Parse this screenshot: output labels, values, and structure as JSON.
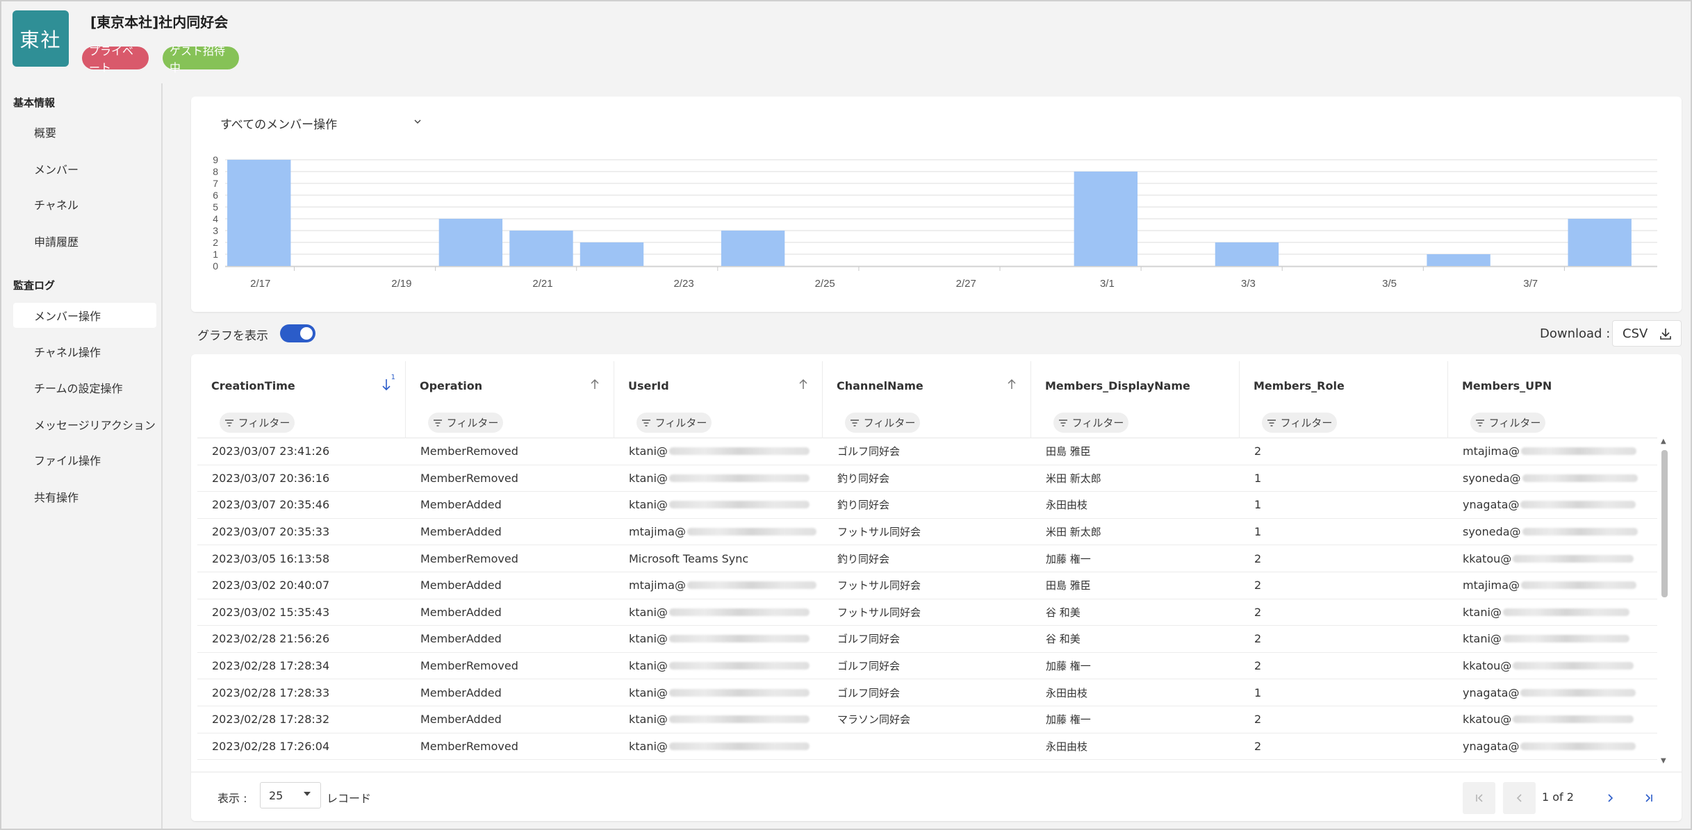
{
  "team": {
    "avatar_text": "東社",
    "title": "[東京本社]社内同好会",
    "badges": {
      "private": "プライベート",
      "guest": "ゲスト招待中"
    }
  },
  "sidebar": {
    "section_basic": "基本情報",
    "basic_items": [
      "概要",
      "メンバー",
      "チャネル",
      "申請履歴"
    ],
    "section_audit": "監査ログ",
    "audit_items": [
      "メンバー操作",
      "チャネル操作",
      "チームの設定操作",
      "メッセージリアクション",
      "ファイル操作",
      "共有操作"
    ],
    "active_item": "メンバー操作"
  },
  "chart": {
    "selector_label": "すべてのメンバー操作"
  },
  "chart_data": {
    "type": "bar",
    "categories": [
      "2/17",
      "2/18",
      "2/19",
      "2/20",
      "2/21",
      "2/22",
      "2/23",
      "2/24",
      "2/25",
      "2/26",
      "2/27",
      "2/28",
      "3/1",
      "3/2",
      "3/3",
      "3/4",
      "3/5",
      "3/6",
      "3/7",
      "3/8"
    ],
    "x_tick_labels": [
      "2/17",
      "2/19",
      "2/21",
      "2/23",
      "2/25",
      "2/27",
      "3/1",
      "3/3",
      "3/5",
      "3/7"
    ],
    "values": [
      9,
      0,
      0,
      4,
      3,
      2,
      0,
      3,
      0,
      0,
      0,
      0,
      8,
      0,
      2,
      0,
      0,
      1,
      0,
      4
    ],
    "y_ticks": [
      0,
      1,
      2,
      3,
      4,
      5,
      6,
      7,
      8,
      9
    ],
    "ylim": [
      0,
      9
    ],
    "grid": true,
    "bar_color": "#9dc3f5",
    "title": "",
    "xlabel": "",
    "ylabel": ""
  },
  "controls": {
    "toggle_label": "グラフを表示",
    "toggle_on": true,
    "download_label": "Download :",
    "csv_label": "CSV"
  },
  "table": {
    "columns": [
      "CreationTime",
      "Operation",
      "UserId",
      "ChannelName",
      "Members_DisplayName",
      "Members_Role",
      "Members_UPN"
    ],
    "filter_label": "フィルター",
    "sort_priority": "1",
    "rows": [
      [
        "2023/03/07 23:41:26",
        "MemberRemoved",
        "ktani@",
        "ゴルフ同好会",
        "田島 雅臣",
        "2",
        "mtajima@"
      ],
      [
        "2023/03/07 20:36:16",
        "MemberRemoved",
        "ktani@",
        "釣り同好会",
        "米田 新太郎",
        "1",
        "syoneda@"
      ],
      [
        "2023/03/07 20:35:46",
        "MemberAdded",
        "ktani@",
        "釣り同好会",
        "永田由枝",
        "1",
        "ynagata@"
      ],
      [
        "2023/03/07 20:35:33",
        "MemberAdded",
        "mtajima@",
        "フットサル同好会",
        "米田 新太郎",
        "1",
        "syoneda@"
      ],
      [
        "2023/03/05 16:13:58",
        "MemberRemoved",
        "Microsoft Teams Sync",
        "釣り同好会",
        "加藤 権一",
        "2",
        "kkatou@"
      ],
      [
        "2023/03/02 20:40:07",
        "MemberAdded",
        "mtajima@",
        "フットサル同好会",
        "田島 雅臣",
        "2",
        "mtajima@"
      ],
      [
        "2023/03/02 15:35:43",
        "MemberAdded",
        "ktani@",
        "フットサル同好会",
        "谷 和美",
        "2",
        "ktani@"
      ],
      [
        "2023/02/28 21:56:26",
        "MemberAdded",
        "ktani@",
        "ゴルフ同好会",
        "谷 和美",
        "2",
        "ktani@"
      ],
      [
        "2023/02/28 17:28:34",
        "MemberRemoved",
        "ktani@",
        "ゴルフ同好会",
        "加藤 権一",
        "2",
        "kkatou@"
      ],
      [
        "2023/02/28 17:28:33",
        "MemberAdded",
        "ktani@",
        "ゴルフ同好会",
        "永田由枝",
        "1",
        "ynagata@"
      ],
      [
        "2023/02/28 17:28:32",
        "MemberAdded",
        "ktani@",
        "マラソン同好会",
        "加藤 権一",
        "2",
        "kkatou@"
      ],
      [
        "2023/02/28 17:26:04",
        "MemberRemoved",
        "ktani@",
        "",
        "永田由枝",
        "2",
        "ynagata@"
      ]
    ]
  },
  "pager": {
    "show_label": "表示 :",
    "page_size": "25",
    "records_label": "レコード",
    "page_indicator": "1 of 2"
  }
}
